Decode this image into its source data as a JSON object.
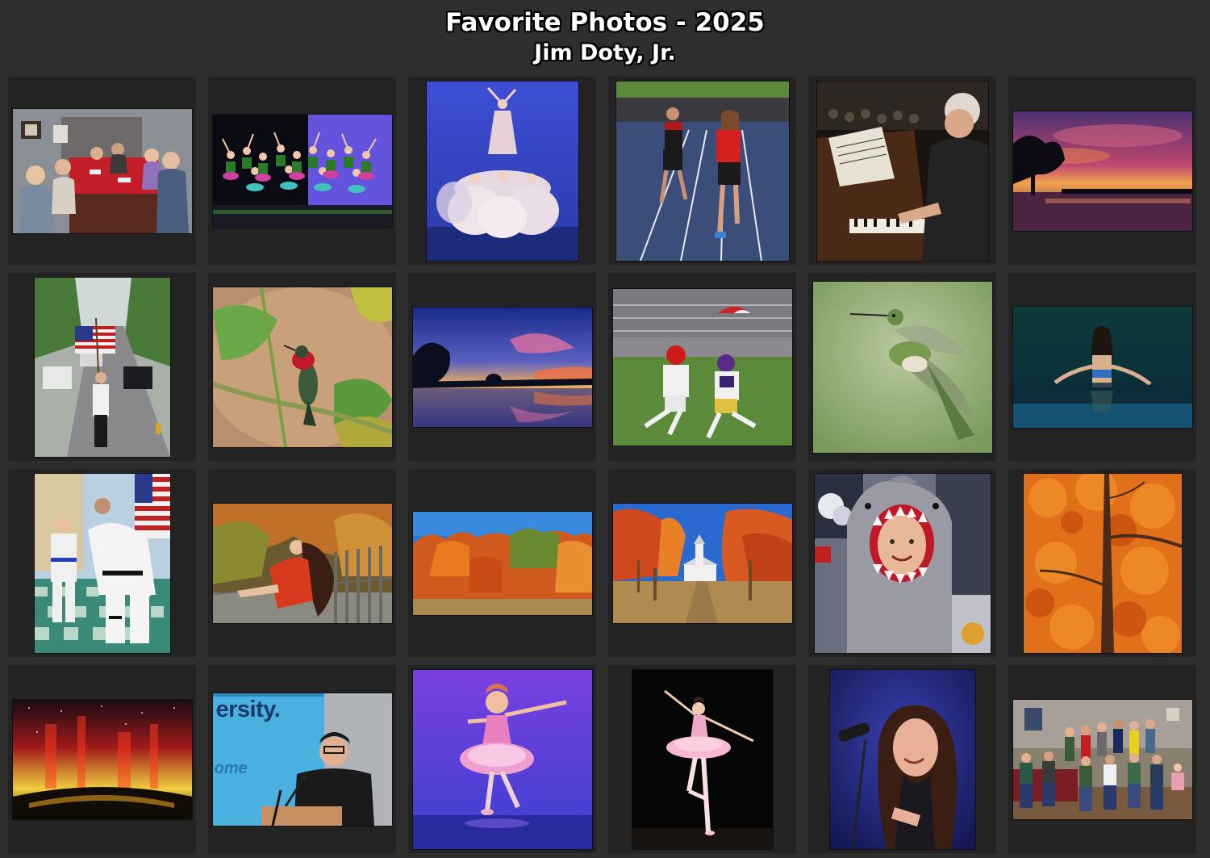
{
  "header": {
    "title": "Favorite Photos - 2025",
    "subtitle": "Jim Doty, Jr."
  },
  "tiles": [
    {
      "subject": "family-dinner",
      "orientation": "landscape"
    },
    {
      "subject": "dance-troupe",
      "orientation": "landscape"
    },
    {
      "subject": "ballet-fairies",
      "orientation": "portrait"
    },
    {
      "subject": "track-runners",
      "orientation": "portrait"
    },
    {
      "subject": "pianist",
      "orientation": "portrait"
    },
    {
      "subject": "purple-sunset",
      "orientation": "landscape"
    },
    {
      "subject": "flag-parade",
      "orientation": "portrait"
    },
    {
      "subject": "hummingbird-perched",
      "orientation": "landscape"
    },
    {
      "subject": "lake-sunset",
      "orientation": "landscape"
    },
    {
      "subject": "youth-football",
      "orientation": "landscape"
    },
    {
      "subject": "hummingbird-flight",
      "orientation": "landscape"
    },
    {
      "subject": "woman-in-water",
      "orientation": "landscape"
    },
    {
      "subject": "karate-class",
      "orientation": "portrait"
    },
    {
      "subject": "woman-red-dress",
      "orientation": "landscape"
    },
    {
      "subject": "autumn-trees",
      "orientation": "landscape"
    },
    {
      "subject": "country-church",
      "orientation": "landscape"
    },
    {
      "subject": "shark-costume",
      "orientation": "landscape"
    },
    {
      "subject": "orange-leaves",
      "orientation": "portrait"
    },
    {
      "subject": "aurora",
      "orientation": "landscape"
    },
    {
      "subject": "speaker-podium",
      "orientation": "landscape",
      "sign_text": "ersity.",
      "sign_text_2": "ome"
    },
    {
      "subject": "young-ballerina",
      "orientation": "landscape"
    },
    {
      "subject": "ballerina-pink",
      "orientation": "portrait"
    },
    {
      "subject": "singer",
      "orientation": "portrait"
    },
    {
      "subject": "family-group",
      "orientation": "landscape"
    }
  ]
}
